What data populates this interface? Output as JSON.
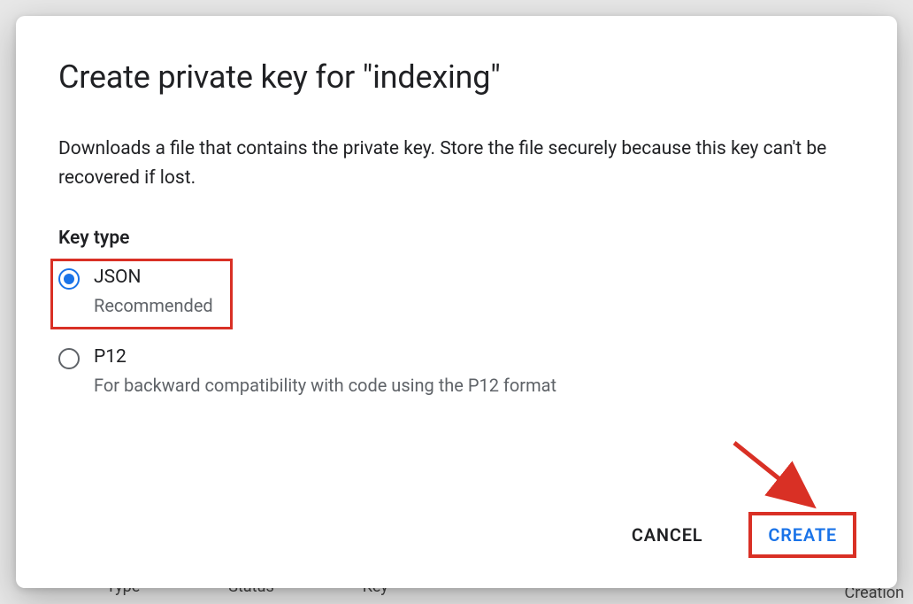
{
  "dialog": {
    "title": "Create private key for \"indexing\"",
    "description": "Downloads a file that contains the private key. Store the file securely because this key can't be recovered if lost.",
    "key_type_label": "Key type",
    "options": {
      "json": {
        "title": "JSON",
        "subtitle": "Recommended"
      },
      "p12": {
        "title": "P12",
        "subtitle": "For backward compatibility with code using the P12 format"
      }
    },
    "actions": {
      "cancel": "CANCEL",
      "create": "CREATE"
    }
  },
  "backdrop": {
    "col1": "Type",
    "col2": "Status",
    "col3": "Key",
    "col_right": "Creation"
  }
}
